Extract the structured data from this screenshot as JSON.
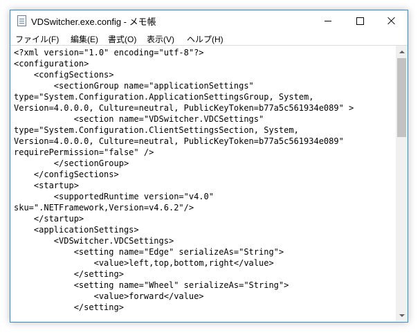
{
  "window": {
    "title": "VDSwitcher.exe.config - メモ帳",
    "icon": "notepad-icon",
    "accent_color": "#2b8fd6"
  },
  "menu": {
    "items": [
      {
        "label": "ファイル(F)"
      },
      {
        "label": "編集(E)"
      },
      {
        "label": "書式(O)"
      },
      {
        "label": "表示(V)"
      },
      {
        "label": "ヘルプ(H)"
      }
    ]
  },
  "editor": {
    "lines": [
      "<?xml version=\"1.0\" encoding=\"utf-8\"?>",
      "<configuration>",
      "    <configSections>",
      "        <sectionGroup name=\"applicationSettings\"",
      "type=\"System.Configuration.ApplicationSettingsGroup, System,",
      "Version=4.0.0.0, Culture=neutral, PublicKeyToken=b77a5c561934e089\" >",
      "            <section name=\"VDSwitcher.VDCSettings\"",
      "type=\"System.Configuration.ClientSettingsSection, System,",
      "Version=4.0.0.0, Culture=neutral, PublicKeyToken=b77a5c561934e089\"",
      "requirePermission=\"false\" />",
      "        </sectionGroup>",
      "    </configSections>",
      "    <startup>",
      "        <supportedRuntime version=\"v4.0\"",
      "sku=\".NETFramework,Version=v4.6.2\"/>",
      "    </startup>",
      "    <applicationSettings>",
      "        <VDSwitcher.VDCSettings>",
      "            <setting name=\"Edge\" serializeAs=\"String\">",
      "                <value>left,top,bottom,right</value>",
      "            </setting>",
      "            <setting name=\"Wheel\" serializeAs=\"String\">",
      "                <value>forward</value>",
      "            </setting>"
    ]
  },
  "scrollbar": {
    "position_fraction": 0.0
  }
}
